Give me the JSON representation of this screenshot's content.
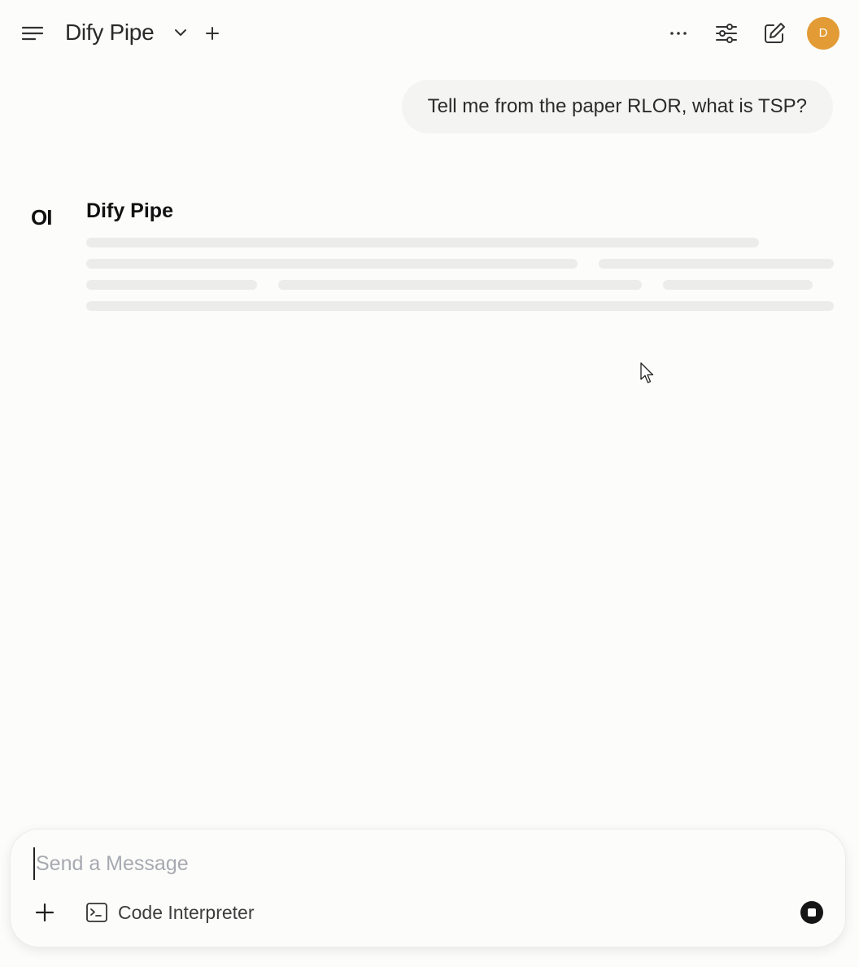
{
  "header": {
    "model_name": "Dify Pipe",
    "avatar_initial": "D",
    "avatar_color": "#e29b35",
    "icons": {
      "menu": "menu-icon",
      "model_dropdown": "chevron-down-icon",
      "add_model": "plus-icon",
      "more": "ellipsis-icon",
      "controls": "sliders-icon",
      "new_chat": "pencil-square-icon"
    }
  },
  "conversation": {
    "user_message": "Tell me from the paper RLOR, what is TSP?",
    "assistant": {
      "logo_text": "OI",
      "name": "Dify Pipe",
      "state": "loading"
    }
  },
  "composer": {
    "placeholder": "Send a Message",
    "value": "",
    "code_interpreter_label": "Code Interpreter",
    "icons": {
      "attach": "plus-icon",
      "code_interpreter": "terminal-icon",
      "stop": "stop-icon"
    }
  }
}
